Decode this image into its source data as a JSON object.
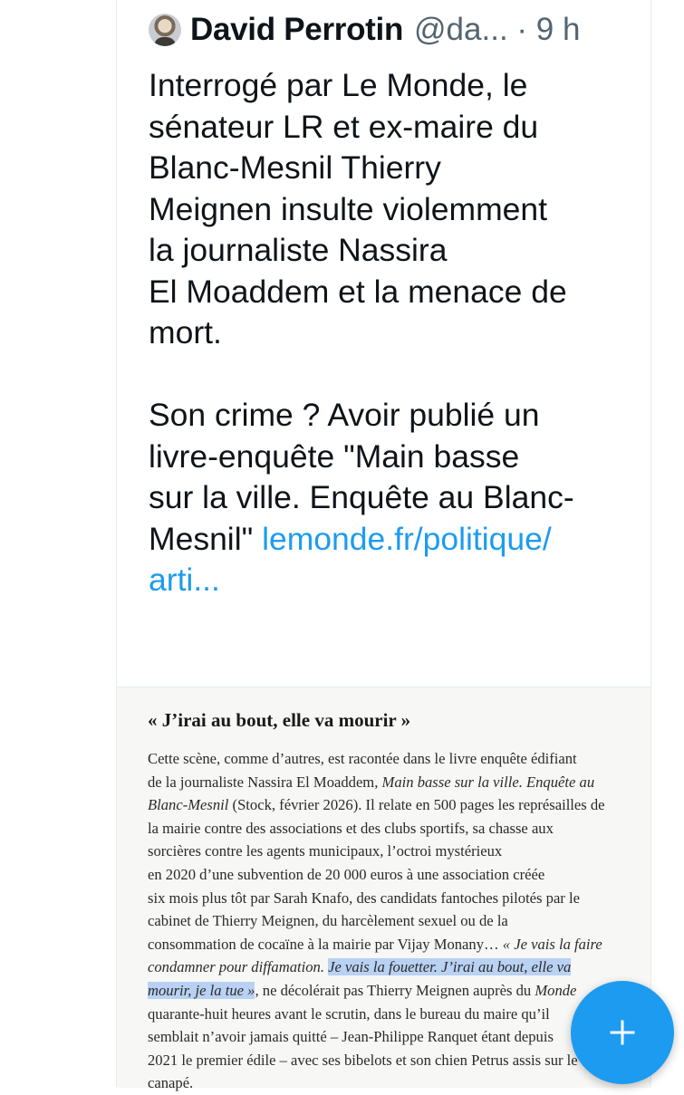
{
  "tweet": {
    "author_name": "David Perrotin",
    "handle_and_time": "@da... · 9 h",
    "lines": [
      "Interrogé par Le Monde, le",
      "sénateur LR et ex-maire du",
      "Blanc-Mesnil Thierry",
      "Meignen insulte violemment",
      "la journaliste Nassira",
      "El Moaddem et la menace de",
      "mort."
    ],
    "lines2": [
      "Son crime ? Avoir publié un",
      "livre-enquête \"Main basse",
      "sur la ville. Enquête au Blanc-"
    ],
    "last_prefix": "Mesnil\" ",
    "link_part1": "lemonde.fr/politique/",
    "link_part2": "arti..."
  },
  "article": {
    "title": "« J’irai au bout, elle va mourir »",
    "l1": "Cette scène, comme d’autres, est racontée dans le livre enquête édifiant",
    "l2a": "de la journaliste Nassira El Moaddem, ",
    "l2b": "Main basse sur la ville. Enquête au",
    "l3a": "Blanc-Mesnil",
    "l3b": " (Stock, février 2026). Il relate en 500 pages les représailles de",
    "l4": "la mairie contre des associations et des clubs sportifs, sa chasse aux",
    "l5": "sorcières contre les agents municipaux, l’octroi mystérieux",
    "l6": "en 2020 d’une subvention de 20 000 euros à une association créée",
    "l7": "six mois plus tôt par Sarah Knafo, des candidats fantoches pilotés par le",
    "l8": "cabinet de Thierry Meignen, du harcèlement sexuel ou de la",
    "l9a": "consommation de cocaïne à la mairie par Vijay Monany… ",
    "l9b": "« Je vais la faire",
    "l10a": "condamner pour diffamation. ",
    "l10b": "Je vais la fouetter. J’irai au bout, elle va",
    "l11a": "mourir, je la tue »",
    "l11b": ", ne décolérait pas Thierry Meignen auprès du ",
    "l11c": "Monde",
    "l12": "quarante-huit heures avant le scrutin, dans le bureau du maire qu’il",
    "l13": "semblait n’avoir jamais quitté – Jean-Philippe Ranquet étant depuis",
    "l14": "2021 le premier édile – avec ses bibelots et son chien Petrus assis sur le",
    "l15": "canapé."
  },
  "fab": {
    "icon": "plus-icon"
  },
  "colors": {
    "accent": "#1d9bf0",
    "highlight": "#b9d1f3"
  }
}
